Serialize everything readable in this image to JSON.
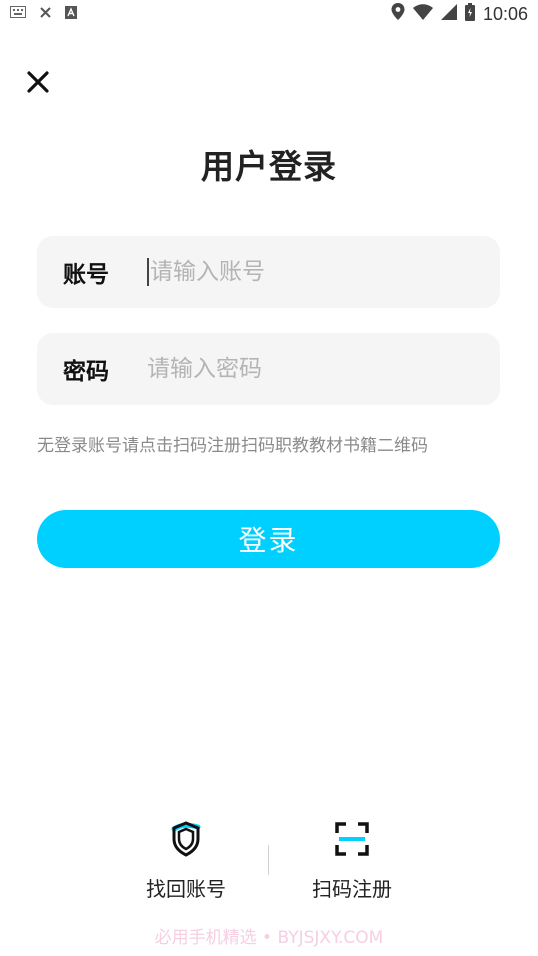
{
  "status_bar": {
    "left_icons": [
      "keyboard-icon",
      "close-icon",
      "text-icon"
    ],
    "right_icons": [
      "location-icon",
      "wifi-icon",
      "signal-icon",
      "battery-icon"
    ],
    "time": "10:06"
  },
  "page": {
    "title": "用户登录"
  },
  "account_field": {
    "label": "账号",
    "placeholder": "请输入账号",
    "value": ""
  },
  "password_field": {
    "label": "密码",
    "placeholder": "请输入密码",
    "value": ""
  },
  "hint": "无登录账号请点击扫码注册扫码职教教材书籍二维码",
  "login_button": {
    "label": "登录",
    "color": "#00d0ff"
  },
  "bottom": {
    "find_account": {
      "label": "找回账号",
      "icon": "shield-icon"
    },
    "scan_register": {
      "label": "扫码注册",
      "icon": "scan-icon"
    }
  },
  "watermark": "必用手机精选 • BYJSJXY.COM",
  "colors": {
    "accent": "#00d0ff",
    "field_bg": "#f5f5f5",
    "hint": "#8a8a8a"
  }
}
